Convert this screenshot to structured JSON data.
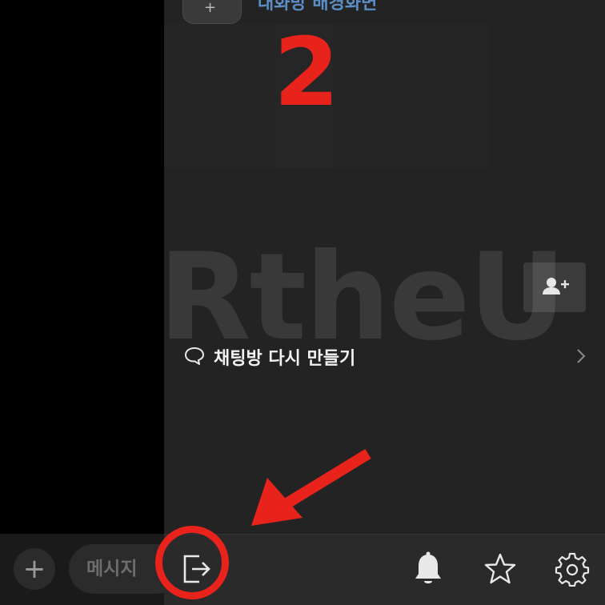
{
  "chat": {
    "input_placeholder": "메시지",
    "plus_symbol": "+"
  },
  "drawer": {
    "top_link": "대화방 배경화면",
    "recreate_label": "채팅방 다시 만들기"
  },
  "annotation": {
    "step_number": "2",
    "watermark": "RtheU",
    "accent_color": "#e8231b"
  },
  "icons": {
    "leave": "exit-icon",
    "notify": "bell-icon",
    "favorite": "star-icon",
    "settings": "gear-icon",
    "invite": "add-user-icon",
    "chat": "speech-bubble-icon",
    "forward": "chevron-right-icon"
  }
}
